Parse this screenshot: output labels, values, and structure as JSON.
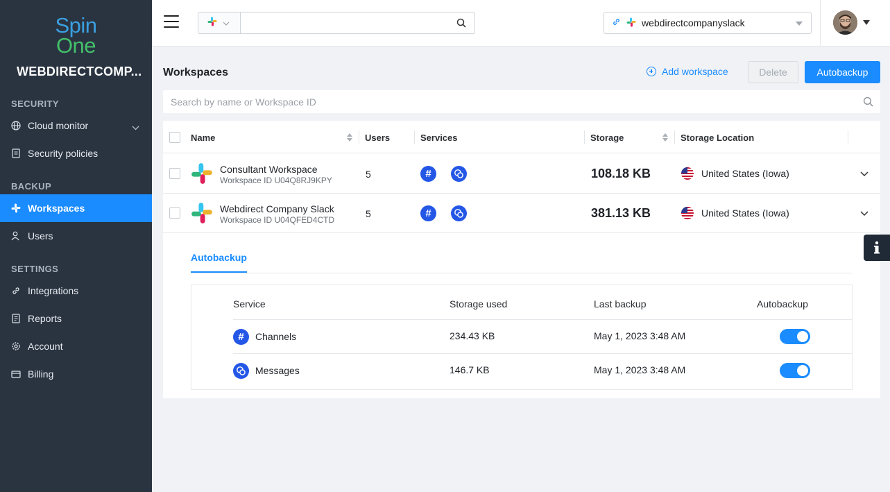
{
  "brand": {
    "logo_line1": "Spin",
    "logo_line2": "One",
    "org_name": "WEBDIRECTCOMP..."
  },
  "sidebar": {
    "sections": [
      {
        "title": "SECURITY"
      },
      {
        "title": "BACKUP"
      },
      {
        "title": "SETTINGS"
      }
    ],
    "items": [
      {
        "label": "Cloud monitor",
        "icon": "globe-icon"
      },
      {
        "label": "Security policies",
        "icon": "document-icon"
      },
      {
        "label": "Workspaces",
        "icon": "slack-icon"
      },
      {
        "label": "Users",
        "icon": "user-icon"
      },
      {
        "label": "Integrations",
        "icon": "link-icon"
      },
      {
        "label": "Reports",
        "icon": "report-icon"
      },
      {
        "label": "Account",
        "icon": "gear-icon"
      },
      {
        "label": "Billing",
        "icon": "card-icon"
      }
    ]
  },
  "topbar": {
    "workspace_selected": "webdirectcompanyslack"
  },
  "main": {
    "title": "Workspaces",
    "add_workspace": "Add workspace",
    "delete": "Delete",
    "autobackup": "Autobackup",
    "search_placeholder": "Search by name or Workspace ID"
  },
  "table": {
    "headers": [
      "Name",
      "Users",
      "Services",
      "Storage",
      "Storage Location"
    ],
    "rows": [
      {
        "name": "Consultant Workspace",
        "workspace_id": "Workspace ID U04Q8RJ9KPY",
        "users": "5",
        "storage": "108.18 KB",
        "location": "United States (Iowa)"
      },
      {
        "name": "Webdirect Company Slack",
        "workspace_id": "Workspace ID U04QFED4CTD",
        "users": "5",
        "storage": "381.13 KB",
        "location": "United States (Iowa)"
      }
    ]
  },
  "detail": {
    "tab": "Autobackup",
    "headers": [
      "Service",
      "Storage used",
      "Last backup",
      "Autobackup"
    ],
    "rows": [
      {
        "service": "Channels",
        "icon": "hash-icon",
        "storage_used": "234.43 KB",
        "last_backup": "May 1, 2023 3:48 AM",
        "autobackup": true
      },
      {
        "service": "Messages",
        "icon": "messages-icon",
        "storage_used": "146.7 KB",
        "last_backup": "May 1, 2023 3:48 AM",
        "autobackup": true
      }
    ]
  },
  "colors": {
    "sidebar_bg": "#2a3441",
    "accent": "#1a8cff",
    "service_icon": "#2457e6"
  }
}
